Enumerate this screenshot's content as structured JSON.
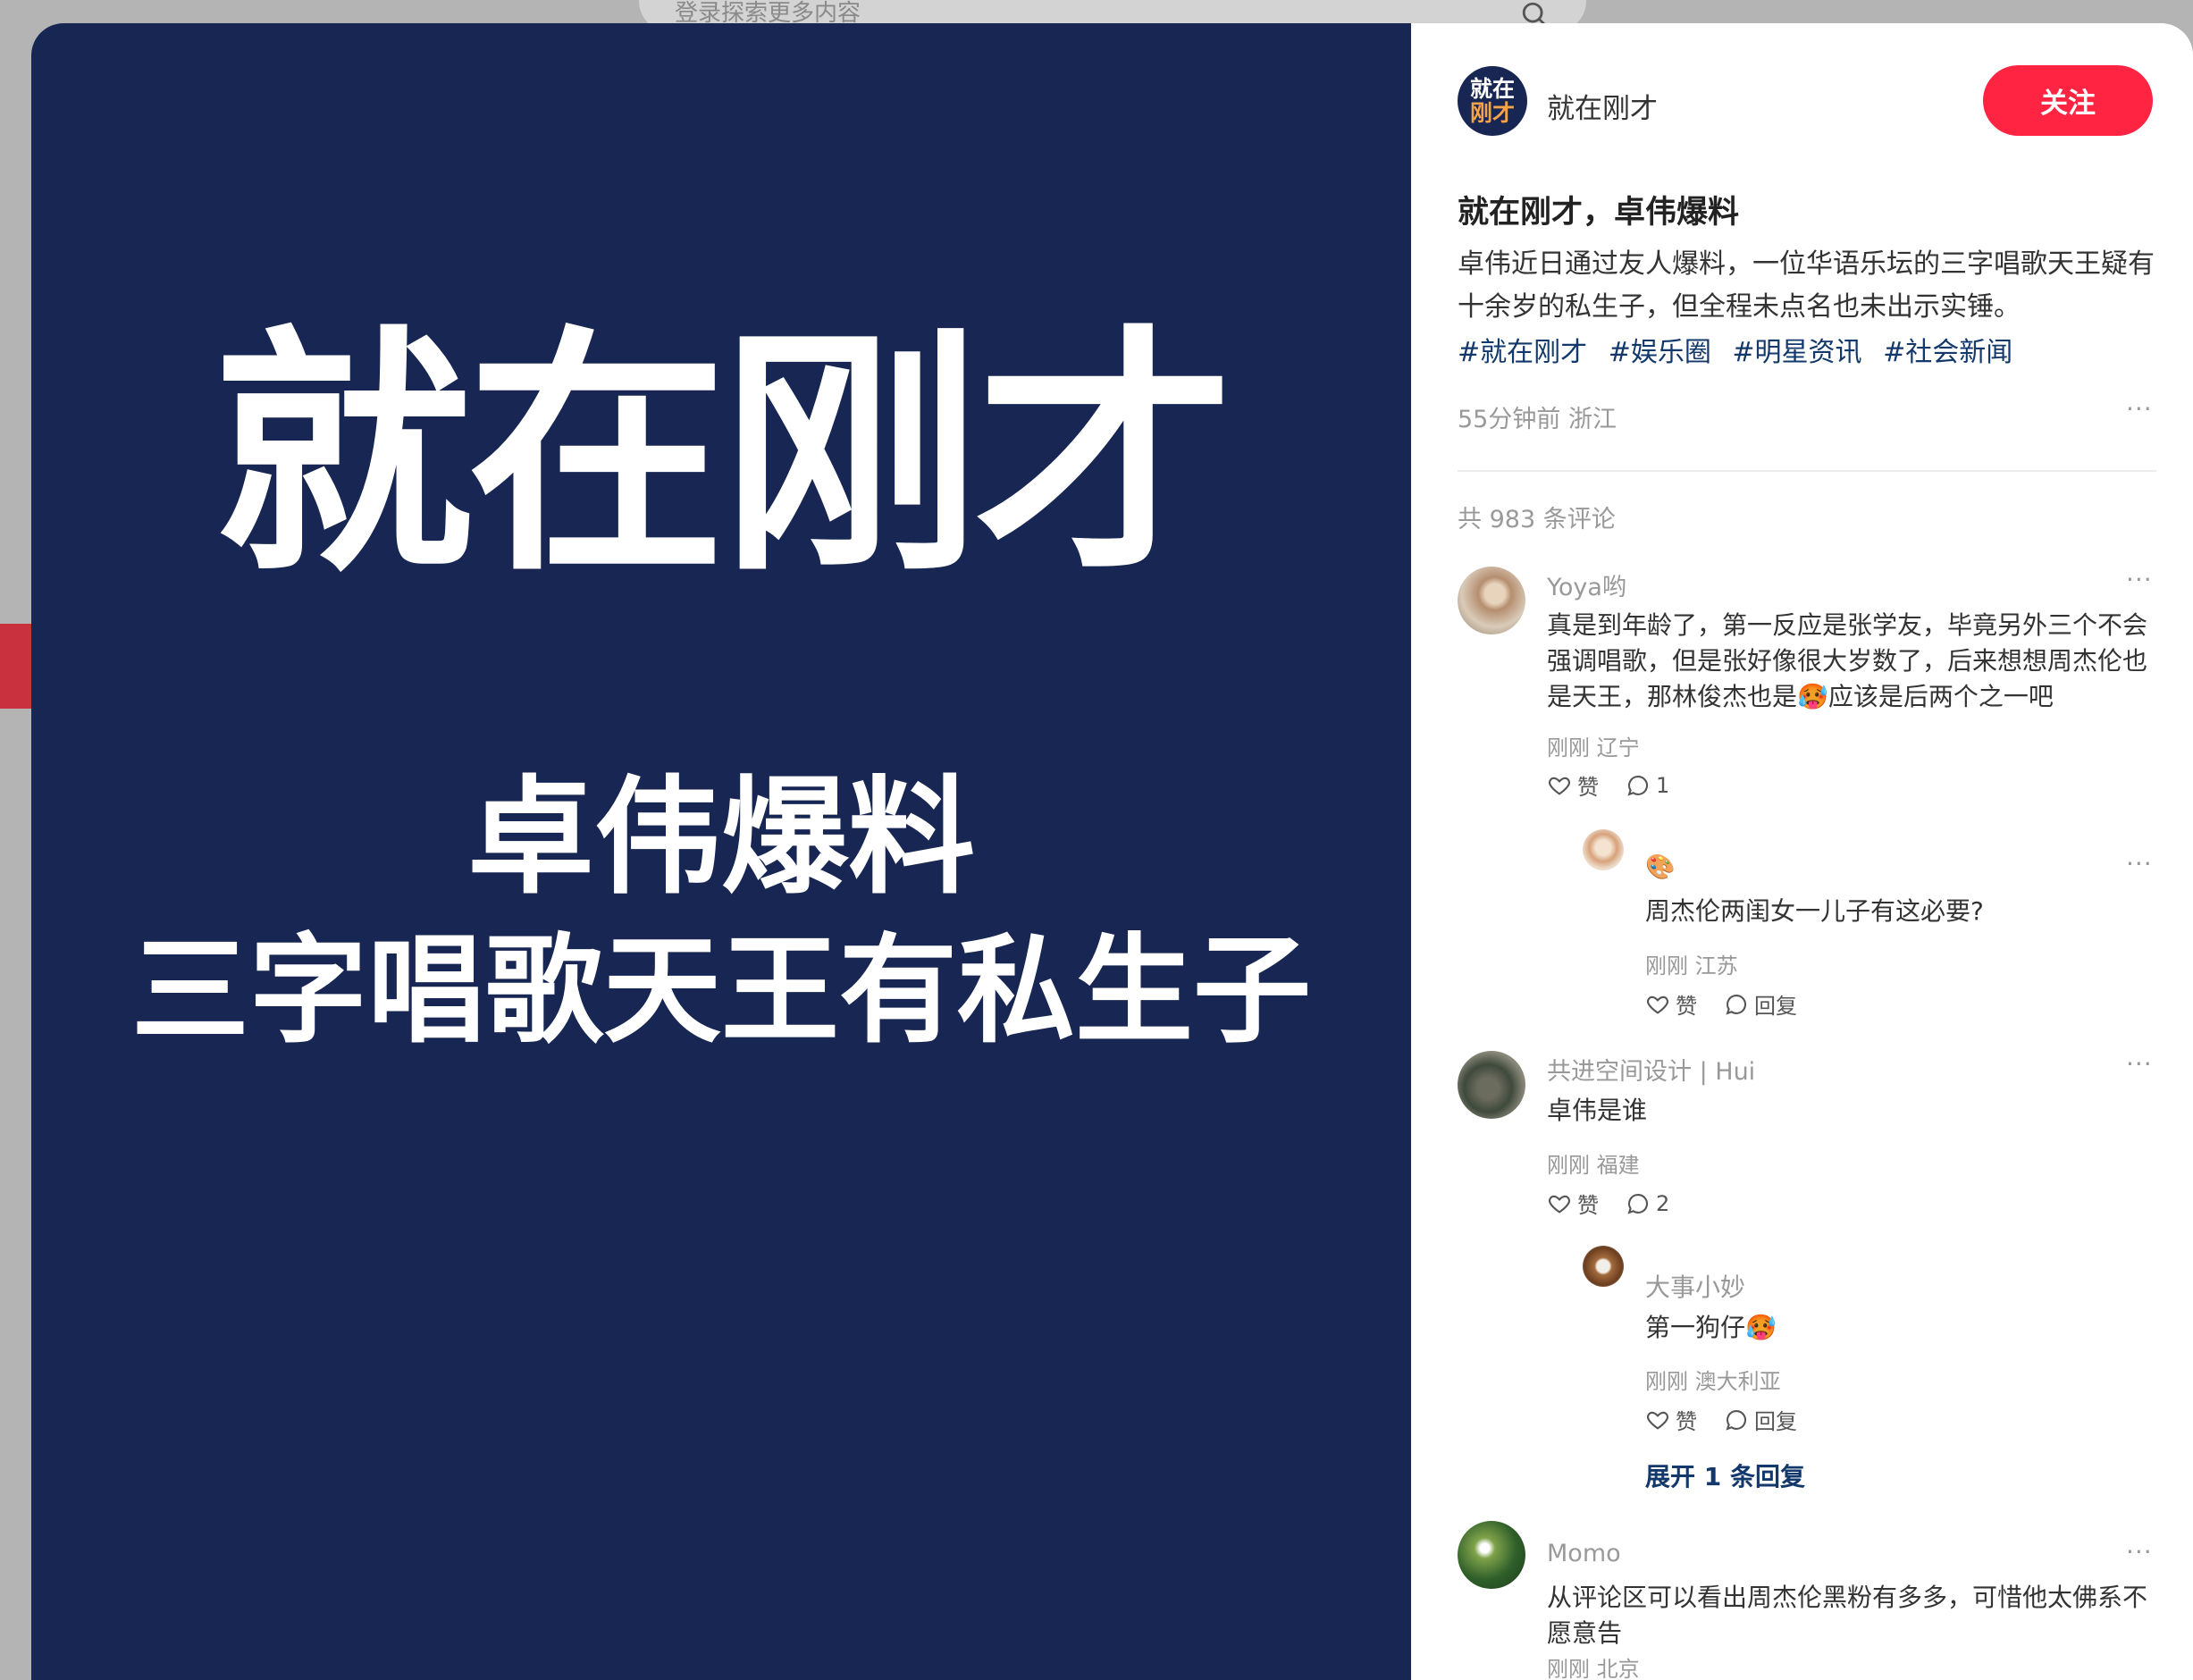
{
  "search": {
    "placeholder": "登录探索更多内容"
  },
  "media": {
    "line1": "就在刚才",
    "line2": "卓伟爆料",
    "line3": "三字唱歌天王有私生子"
  },
  "author": {
    "avatar_line1": "就在",
    "avatar_line2": "刚才",
    "name": "就在刚才",
    "follow_label": "关注"
  },
  "note": {
    "title": "就在刚才，卓伟爆料",
    "desc": "卓伟近日通过友人爆料，一位华语乐坛的三字唱歌天王疑有十余岁的私生子，但全程未点名也未出示实锤。",
    "tags": [
      "#就在刚才",
      "#娱乐圈",
      "#明星资讯",
      "#社会新闻"
    ],
    "meta": "55分钟前 浙江",
    "more": "···"
  },
  "comments": {
    "count_label": "共 983 条评论",
    "items": [
      {
        "name": "Yoya哟",
        "text": "真是到年龄了，第一反应是张学友，毕竟另外三个不会强调唱歌，但是张好像很大岁数了，后来想想周杰伦也是天王，那林俊杰也是🥵应该是后两个之一吧",
        "meta": "刚刚 辽宁",
        "like_label": "赞",
        "reply_count": "1",
        "reply": {
          "name": "🎨",
          "text": "周杰伦两闺女一儿子有这必要?",
          "meta": "刚刚 江苏",
          "like_label": "赞",
          "reply_label": "回复"
        }
      },
      {
        "name": "共进空间设计 | Hui",
        "text": "卓伟是谁",
        "meta": "刚刚 福建",
        "like_label": "赞",
        "reply_count": "2",
        "reply": {
          "name": "大事小妙",
          "text": "第一狗仔🥵",
          "meta": "刚刚 澳大利亚",
          "like_label": "赞",
          "reply_label": "回复"
        },
        "expand_label": "展开 1 条回复"
      },
      {
        "name": "Momo",
        "text": "从评论区可以看出周杰伦黑粉有多多，可惜他太佛系不愿意告",
        "meta": "刚刚 北京"
      }
    ]
  },
  "colors": {
    "accent": "#ff2442",
    "media_bg": "#172652",
    "tag": "#13386c"
  }
}
